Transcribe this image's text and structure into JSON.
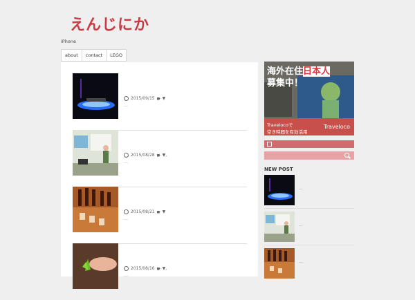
{
  "site": {
    "logo": "えんじにか",
    "tagline": "iPhone"
  },
  "nav": {
    "items": [
      "about",
      "contact",
      "LEGO"
    ]
  },
  "posts": [
    {
      "date": "2015/09/15",
      "tags": "▼",
      "excerpt": "…"
    },
    {
      "date": "2015/08/28",
      "tags": "▼,",
      "excerpt": "…"
    },
    {
      "date": "2015/08/21",
      "tags": "▼",
      "excerpt": "…"
    },
    {
      "date": "2015/08/16",
      "tags": "▼,",
      "excerpt": "…"
    }
  ],
  "sidebar": {
    "ad": {
      "headline1": "海外在住",
      "headline_highlight": "日本人",
      "headline2": "募集中！",
      "caption1": "Travelocoで",
      "caption2": "空き時間を有効活用",
      "brand": "Traveloco"
    },
    "new_post_title": "NEW POST",
    "new_posts": [
      {
        "excerpt": "…"
      },
      {
        "excerpt": "…"
      },
      {
        "excerpt": "…"
      }
    ]
  },
  "colors": {
    "accent": "#d36a6f",
    "accent_light": "#e8a3a7",
    "logo": "#c83a44"
  }
}
